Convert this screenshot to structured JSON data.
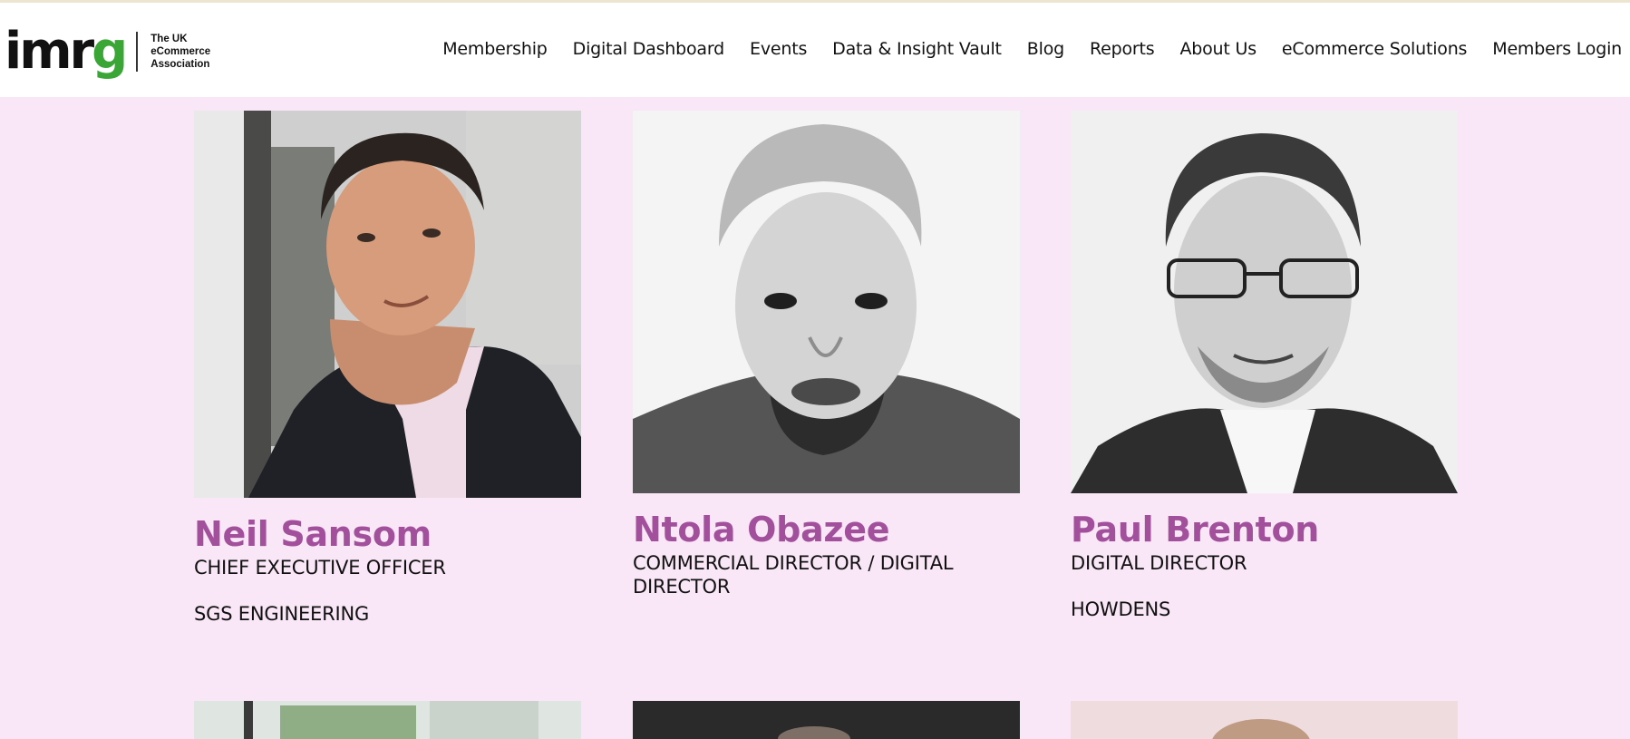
{
  "header": {
    "logo": {
      "wordmark": "imrg",
      "tagline": [
        "The UK",
        "eCommerce",
        "Association"
      ]
    },
    "nav": [
      "Membership",
      "Digital Dashboard",
      "Events",
      "Data & Insight Vault",
      "Blog",
      "Reports",
      "About Us",
      "eCommerce Solutions",
      "Members Login"
    ]
  },
  "people": [
    {
      "name": "Neil Sansom",
      "role": "CHIEF EXECUTIVE OFFICER",
      "company": "SGS ENGINEERING"
    },
    {
      "name": "Ntola Obazee",
      "role": "COMMERCIAL DIRECTOR / DIGITAL DIRECTOR",
      "company": ""
    },
    {
      "name": "Paul Brenton",
      "role": "DIGITAL DIRECTOR",
      "company": "HOWDENS"
    }
  ],
  "colors": {
    "background": "#f9e6f7",
    "name_accent": "#a2509c",
    "logo_green": "#3aa635"
  }
}
